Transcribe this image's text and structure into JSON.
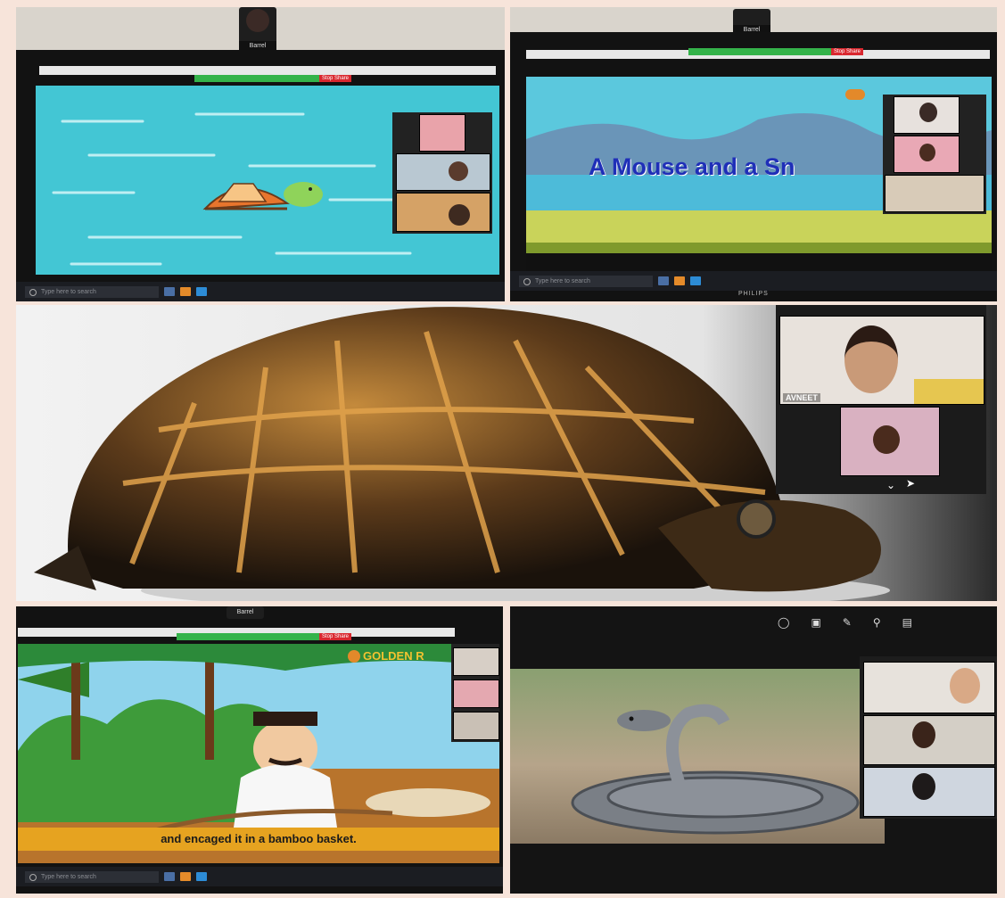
{
  "panels": {
    "top_right": {
      "slide_title": "A Mouse and a Sn"
    },
    "middle": {
      "participant_name": "AVNEET"
    },
    "bottom_left": {
      "logo_text": "GOLDEN R",
      "subtitle": "and encaged it in a bamboo basket."
    },
    "bottom_right": {
      "toolbar_icons": [
        "headphones-icon",
        "screen-icon",
        "pen-icon",
        "search-icon",
        "clipboard-icon"
      ]
    }
  },
  "monitor_brand": "PHILIPS",
  "webcam_label": "Barrel",
  "stop_share_label": "Stop Share",
  "taskbar_search_placeholder": "Type here to search"
}
